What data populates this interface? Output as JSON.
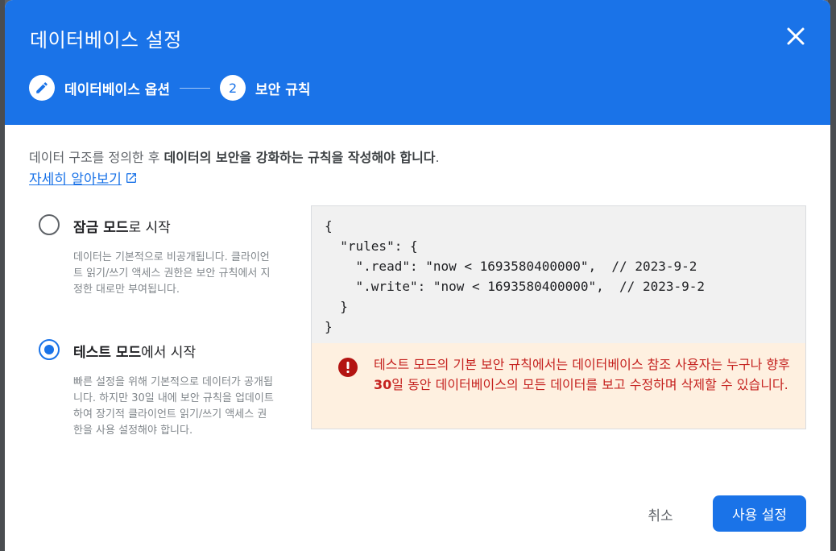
{
  "dialog": {
    "title": "데이터베이스 설정",
    "close_icon": "close-icon"
  },
  "stepper": {
    "steps": [
      {
        "label": "데이터베이스 옵션",
        "icon": "pencil-icon",
        "state": "completed"
      },
      {
        "label": "보안 규칙",
        "number": "2",
        "state": "active"
      }
    ]
  },
  "intro": {
    "text_prefix": "데이터 구조를 정의한 후 ",
    "text_bold": "데이터의 보안을 강화하는 규칙을 작성해야 합니다",
    "text_suffix": ".",
    "learn_more": "자세히 알아보기",
    "learn_more_icon": "open-in-new-icon"
  },
  "options": [
    {
      "title_bold": "잠금 모드",
      "title_rest": "로 시작",
      "selected": false,
      "description": "데이터는 기본적으로 비공개됩니다. 클라이언트 읽기/쓰기 액세스 권한은 보안 규칙에서 지정한 대로만 부여됩니다."
    },
    {
      "title_bold": "테스트 모드",
      "title_rest": "에서 시작",
      "selected": true,
      "description": "빠른 설정을 위해 기본적으로 데이터가 공개됩니다. 하지만 30일 내에 보안 규칙을 업데이트하여 장기적 클라이언트 읽기/쓰기 액세스 권한을 사용 설정해야 합니다."
    }
  ],
  "rules_code": "{\n  \"rules\": {\n    \".read\": \"now < 1693580400000\",  // 2023-9-2\n    \".write\": \"now < 1693580400000\",  // 2023-9-2\n  }\n}",
  "warning": {
    "icon": "error-icon",
    "text_prefix": "테스트 모드의 기본 보안 규칙에서는 데이터베이스 참조 사용자는 누구나 향후 ",
    "text_bold": "30",
    "text_suffix": "일 동안 데이터베이스의 모든 데이터를 보고 수정하며 삭제할 수 있습니다."
  },
  "actions": {
    "cancel": "취소",
    "enable": "사용 설정"
  },
  "colors": {
    "primary": "#1a73e8",
    "warning_bg": "#fef0e0",
    "warning_text": "#c5221f"
  }
}
